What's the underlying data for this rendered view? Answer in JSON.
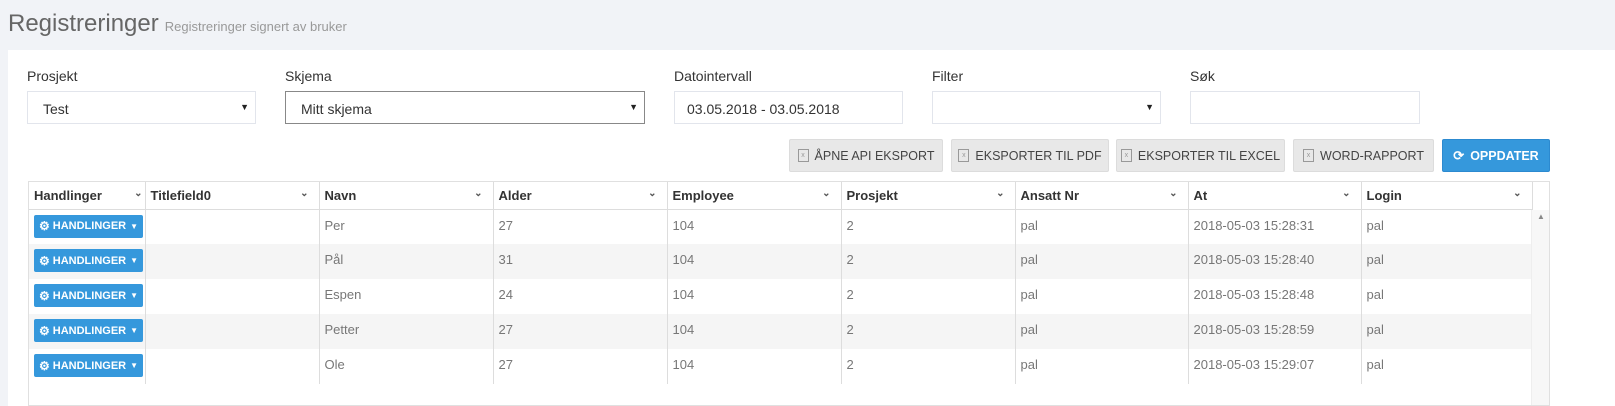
{
  "header": {
    "title": "Registreringer",
    "subtitle": "Registreringer signert av bruker"
  },
  "filters": {
    "project": {
      "label": "Prosjekt",
      "value": "Test"
    },
    "schema": {
      "label": "Skjema",
      "value": "Mitt skjema"
    },
    "date_range": {
      "label": "Datointervall",
      "value": "03.05.2018 - 03.05.2018"
    },
    "filter": {
      "label": "Filter",
      "value": ""
    },
    "search": {
      "label": "Søk",
      "value": ""
    }
  },
  "buttons": {
    "api_export": "ÅPNE API EKSPORT",
    "export_pdf": "EKSPORTER TIL PDF",
    "export_excel": "EKSPORTER TIL EXCEL",
    "word_report": "WORD-RAPPORT",
    "update": "OPPDATER"
  },
  "table": {
    "columns": [
      "Handlinger",
      "Titlefield0",
      "Navn",
      "Alder",
      "Employee",
      "Prosjekt",
      "Ansatt Nr",
      "At",
      "Login"
    ],
    "action_label": "HANDLINGER",
    "rows": [
      {
        "titlefield0": "",
        "navn": "Per",
        "alder": "27",
        "employee": "104",
        "prosjekt": "2",
        "ansatt_nr": "pal",
        "at": "2018-05-03 15:28:31",
        "login": "pal"
      },
      {
        "titlefield0": "",
        "navn": "Pål",
        "alder": "31",
        "employee": "104",
        "prosjekt": "2",
        "ansatt_nr": "pal",
        "at": "2018-05-03 15:28:40",
        "login": "pal"
      },
      {
        "titlefield0": "",
        "navn": "Espen",
        "alder": "24",
        "employee": "104",
        "prosjekt": "2",
        "ansatt_nr": "pal",
        "at": "2018-05-03 15:28:48",
        "login": "pal"
      },
      {
        "titlefield0": "",
        "navn": "Petter",
        "alder": "27",
        "employee": "104",
        "prosjekt": "2",
        "ansatt_nr": "pal",
        "at": "2018-05-03 15:28:59",
        "login": "pal"
      },
      {
        "titlefield0": "",
        "navn": "Ole",
        "alder": "27",
        "employee": "104",
        "prosjekt": "2",
        "ansatt_nr": "pal",
        "at": "2018-05-03 15:29:07",
        "login": "pal"
      }
    ]
  },
  "colors": {
    "accent": "#3598dc",
    "grey_button": "#e8e8e8",
    "page_bg": "#f1f3f7"
  }
}
